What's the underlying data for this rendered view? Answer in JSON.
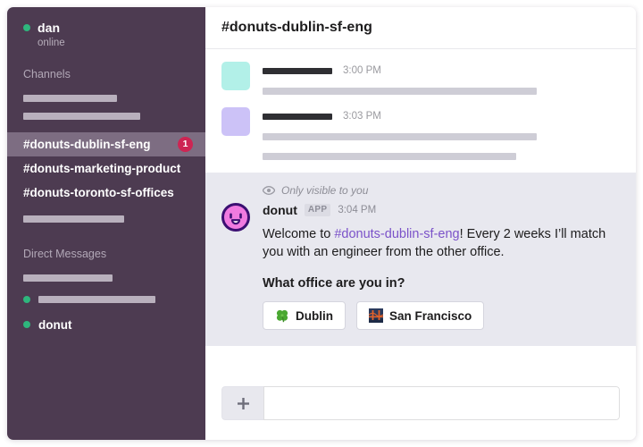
{
  "sidebar": {
    "user": {
      "name": "dan",
      "status": "online",
      "presence_color": "#2eb67d"
    },
    "channels_label": "Channels",
    "channel_placeholders": [
      105,
      131
    ],
    "channels": [
      {
        "name": "#donuts-dublin-sf-eng",
        "selected": true,
        "badge": "1"
      },
      {
        "name": "#donuts-marketing-product",
        "selected": false,
        "badge": ""
      },
      {
        "name": "#donuts-toronto-sf-offices",
        "selected": false,
        "badge": ""
      }
    ],
    "post_channel_placeholder": 113,
    "dm_label": "Direct Messages",
    "dms": [
      {
        "name": "",
        "placeholder_width": 100,
        "dot": false
      },
      {
        "name": "",
        "placeholder_width": 131,
        "dot": true
      },
      {
        "name": "donut",
        "placeholder_width": 0,
        "dot": true
      }
    ],
    "badge_color": "#cd2553",
    "background_color": "#4d3b51",
    "selected_color": "#7d6d82"
  },
  "header": {
    "channel_title": "#donuts-dublin-sf-eng"
  },
  "messages": [
    {
      "avatar_color": "#b2f0e8",
      "name_bar_width": 78,
      "timestamp": "3:00 PM",
      "text_bars": [
        307
      ]
    },
    {
      "avatar_color": "#ccc2f7",
      "name_bar_width": 78,
      "timestamp": "3:03 PM",
      "text_bars": [
        307,
        284
      ]
    }
  ],
  "ephemeral": {
    "visible_note": "Only visible to you",
    "eye_icon": "eye-icon",
    "sender": "donut",
    "app_badge": "APP",
    "timestamp": "3:04 PM",
    "text_before_link": "Welcome to ",
    "channel_link": "#donuts-dublin-sf-eng",
    "text_after_link": "! Every 2 weeks I’ll match you with an engineer from the other office.",
    "question": "What office are you in?",
    "buttons": [
      {
        "label": "Dublin",
        "emoji": "four-leaf-clover-icon"
      },
      {
        "label": "San Francisco",
        "emoji": "bridge-at-night-icon"
      }
    ],
    "link_color": "#7b52c9",
    "background_color": "#e8e8ef"
  },
  "composer": {
    "add_button": "+",
    "add_button_icon": "plus-icon",
    "input_value": "",
    "input_placeholder": ""
  }
}
